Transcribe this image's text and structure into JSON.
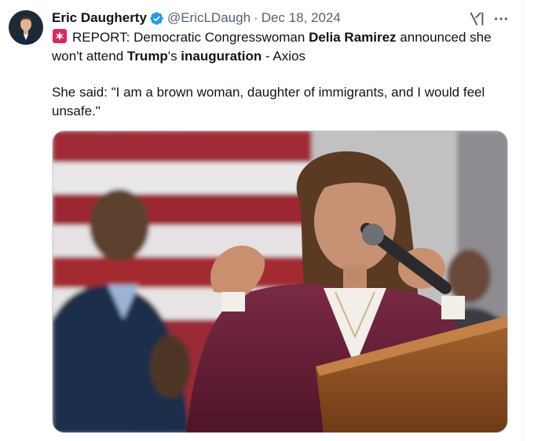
{
  "author": {
    "display_name": "Eric Daugherty",
    "handle": "@EricLDaugh",
    "date": "Dec 18, 2024",
    "separator": "·"
  },
  "icons": {
    "verified": "verified-badge-icon",
    "grok": "grok-icon",
    "more": "more-icon",
    "siren": "rotating-light-icon"
  },
  "tweet": {
    "p1": {
      "a": "REPORT: Democratic Congresswoman ",
      "b": "Delia Ramirez",
      "c": " announced she won't attend ",
      "d": "Trump",
      "e": "'s ",
      "f": "inauguration",
      "g": " - Axios"
    },
    "p2": "She said: \"I am a brown woman, daughter of immigrants, and I would feel unsafe.\""
  },
  "colors": {
    "verified_blue": "#1d9bf0",
    "text_secondary": "#536471",
    "text_primary": "#0f1419"
  }
}
